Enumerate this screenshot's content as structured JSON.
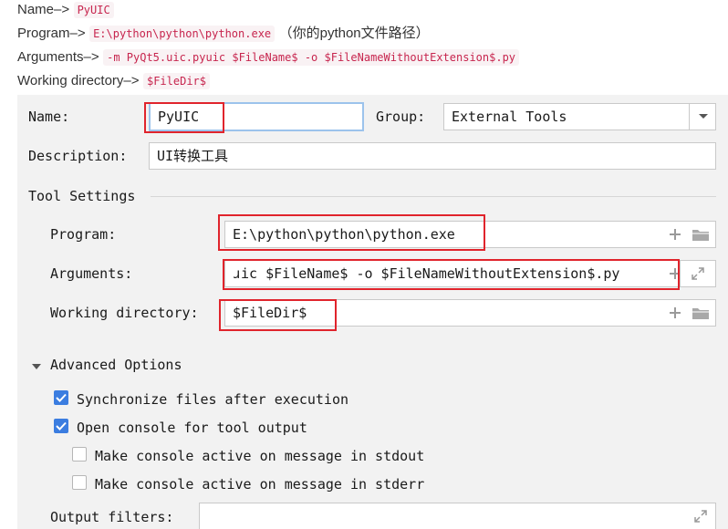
{
  "intro": {
    "name": {
      "label": "Name–>",
      "code": "PyUIC"
    },
    "program": {
      "label": "Program–>",
      "code": "E:\\python\\python\\python.exe",
      "note": "（你的python文件路径）"
    },
    "arguments": {
      "label": "Arguments–>",
      "code": "-m PyQt5.uic.pyuic $FileName$ -o $FileNameWithoutExtension$.py"
    },
    "working_dir": {
      "label": "Working directory–>",
      "code": "$FileDir$"
    }
  },
  "form": {
    "name_label": "Name:",
    "name_value": "PyUIC",
    "group_label": "Group:",
    "group_value": "External Tools",
    "description_label": "Description:",
    "description_value": "UI转换工具",
    "tool_settings_label": "Tool Settings",
    "program_label": "Program:",
    "program_value": "E:\\python\\python\\python.exe",
    "arguments_label": "Arguments:",
    "arguments_value": "ɹic $FileName$ -o $FileNameWithoutExtension$.py",
    "working_dir_label": "Working directory:",
    "working_dir_value": "$FileDir$",
    "advanced_label": "Advanced Options",
    "options": [
      {
        "label": "Synchronize files after execution",
        "checked": true
      },
      {
        "label": "Open console for tool output",
        "checked": true
      },
      {
        "label": "Make console active on message in stdout",
        "checked": false
      },
      {
        "label": "Make console active on message in stderr",
        "checked": false
      }
    ],
    "output_filters_label": "Output filters:",
    "output_filters_value": ""
  },
  "colors": {
    "highlight_box": "#e0242c",
    "checkbox_on": "#3b7de0",
    "code_text": "#c7254e",
    "panel_bg": "#f2f2f2"
  },
  "icons": [
    "plus-icon",
    "folder-icon",
    "expand-icon",
    "chevron-down-icon",
    "triangle-down-icon",
    "checkmark-icon"
  ]
}
